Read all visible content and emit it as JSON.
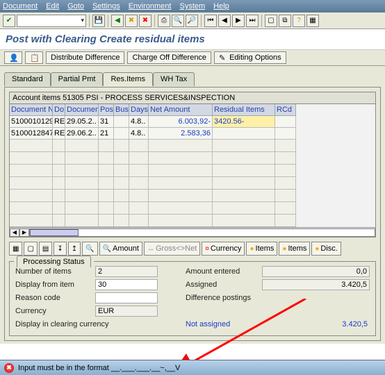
{
  "menu": [
    "Document",
    "Edit",
    "Goto",
    "Settings",
    "Environment",
    "System",
    "Help"
  ],
  "page_title": "Post with Clearing Create residual items",
  "app_toolbar": {
    "distribute": "Distribute Difference",
    "charge_off": "Charge Off Difference",
    "editing": "Editing Options"
  },
  "tabs": [
    "Standard",
    "Partial Pmt",
    "Res.Items",
    "WH Tax"
  ],
  "active_tab": 2,
  "table": {
    "caption": "Account items 51305 PSI - PROCESS SERVICES&INSPECTION",
    "headers": [
      "Document N..",
      "Do..",
      "Document ..",
      "Pos",
      "Busi",
      "Days",
      "Net Amount",
      "Residual Items",
      "RCd"
    ],
    "rows": [
      {
        "docn": "5100010129",
        "dotype": "RE",
        "docdate": "29.05.2..",
        "pos": "31",
        "busi": "",
        "days": "4.8..",
        "net": "6.003,92-",
        "residual": "3420.56-",
        "rcd": ""
      },
      {
        "docn": "5100012847",
        "dotype": "RE",
        "docdate": "29.06.2..",
        "pos": "21",
        "busi": "",
        "days": "4.8..",
        "net": "2.583,36",
        "residual": "",
        "rcd": ""
      }
    ]
  },
  "btnrow": {
    "amount": "Amount",
    "gross": "Gross<>Net",
    "currency": "Currency",
    "items": "Items",
    "items2": "Items",
    "disc": "Disc."
  },
  "processing": {
    "title": "Processing Status",
    "num_items_label": "Number of items",
    "num_items": "2",
    "display_from_label": "Display from item",
    "display_from": "30",
    "reason_label": "Reason code",
    "reason": "",
    "currency_label": "Currency",
    "currency": "EUR",
    "display_curr_label": "Display in clearing currency",
    "amount_entered_label": "Amount entered",
    "amount_entered": "0,0",
    "assigned_label": "Assigned",
    "assigned": "3.420,5",
    "diff_label": "Difference postings",
    "diff": "",
    "not_assigned_label": "Not assigned",
    "not_assigned": "3.420,5"
  },
  "status_msg": "Input must be in the format __.___.___.__~,__V"
}
